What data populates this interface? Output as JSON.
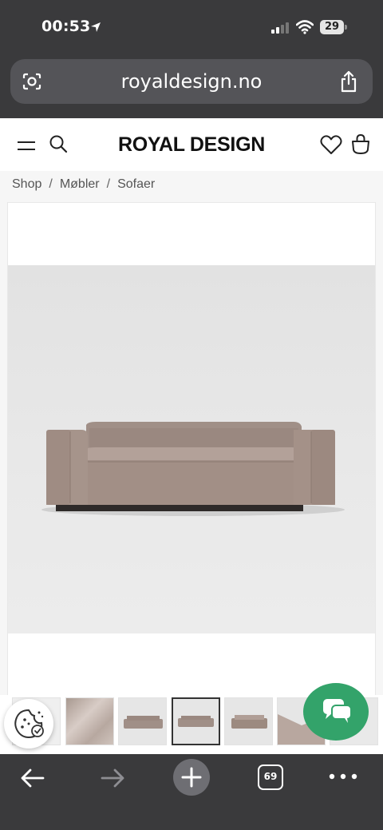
{
  "status_bar": {
    "time": "00:53",
    "battery": "29"
  },
  "browser": {
    "url": "royaldesign.no",
    "tab_count": "69"
  },
  "site": {
    "logo": "ROYAL DESIGN"
  },
  "breadcrumb": [
    "Shop",
    "Møbler",
    "Sofaer"
  ],
  "colors": {
    "browser_chrome": "#3a3a3c",
    "url_field": "#545458",
    "chat_accent": "#33a36a",
    "sofa": "#9e8c84"
  },
  "icons": {
    "header": [
      "menu-icon",
      "search-icon",
      "heart-icon",
      "bag-icon"
    ],
    "toolbar": [
      "back-icon",
      "forward-icon",
      "plus-icon",
      "tabs-icon",
      "more-icon"
    ]
  }
}
